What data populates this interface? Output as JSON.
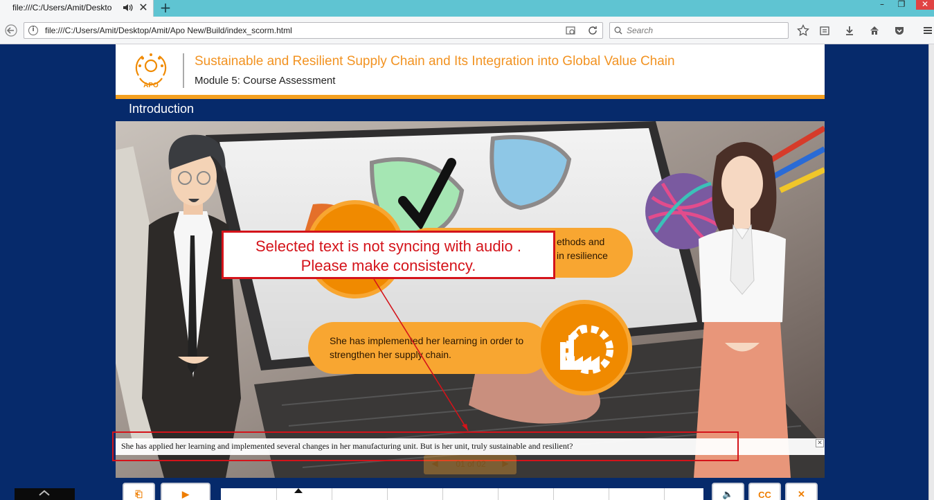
{
  "browser": {
    "tab_title": "file:///C:/Users/Amit/Deskto",
    "tab_close": "✕",
    "new_tab": "+",
    "url": "file:///C:/Users/Amit/Desktop/Amit/Apo New/Build/index_scorm.html",
    "search_placeholder": "Search",
    "window_close": "✕"
  },
  "course": {
    "logo_text": "APO",
    "title": "Sustainable and Resilient Supply Chain and Its Integration into Global Value Chain",
    "module": "Module 5: Course Assessment",
    "section": "Introduction"
  },
  "slide": {
    "pill_top_text_line1": "ethods and",
    "pill_top_text_line2": "in resilience",
    "pill_bottom_text_line1": "She has implemented her learning in order to",
    "pill_bottom_text_line2": "strengthen her supply chain."
  },
  "annotation": {
    "line1": "Selected text is not syncing with audio .",
    "line2": "Please make consistency."
  },
  "caption": {
    "text": "She has applied her learning and implemented several changes in her manufacturing unit. But is her unit, truly sustainable and resilient?",
    "close": "✕"
  },
  "pager": {
    "label": "01 of 02",
    "prev": "◀",
    "next": "▶"
  },
  "controls": {
    "exit_label": "⎗",
    "play_label": "▶",
    "audio_label": "🔈",
    "cc_label": "CC",
    "close_label": "✕",
    "progress_fraction": 0.16
  },
  "colors": {
    "page_bg": "#062a6b",
    "accent_orange": "#f29322",
    "annotation_red": "#d4131a"
  }
}
